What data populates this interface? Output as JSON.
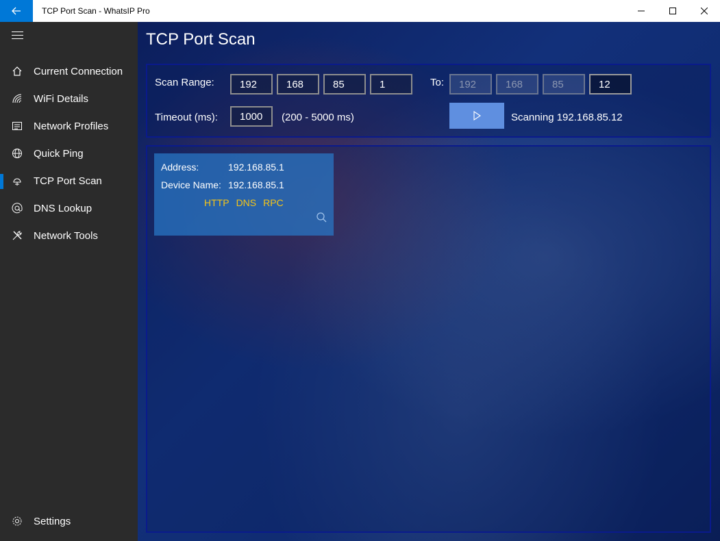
{
  "window": {
    "title": "TCP Port Scan - WhatsIP Pro"
  },
  "sidebar": {
    "items": [
      {
        "label": "Current Connection",
        "icon": "home-icon"
      },
      {
        "label": "WiFi Details",
        "icon": "wifi-icon"
      },
      {
        "label": "Network Profiles",
        "icon": "profiles-icon"
      },
      {
        "label": "Quick Ping",
        "icon": "globe-icon"
      },
      {
        "label": "TCP Port Scan",
        "icon": "port-scan-icon",
        "active": true
      },
      {
        "label": "DNS Lookup",
        "icon": "at-icon"
      },
      {
        "label": "Network Tools",
        "icon": "tools-icon"
      }
    ],
    "settings_label": "Settings"
  },
  "page": {
    "title": "TCP Port Scan"
  },
  "scan": {
    "range_label": "Scan Range:",
    "from": [
      "192",
      "168",
      "85",
      "1"
    ],
    "to_label": "To:",
    "to": [
      "192",
      "168",
      "85",
      "12"
    ],
    "timeout_label": "Timeout (ms):",
    "timeout": "1000",
    "timeout_hint": "(200 - 5000 ms)",
    "status": "Scanning 192.168.85.12"
  },
  "results": [
    {
      "address_label": "Address:",
      "address": "192.168.85.1",
      "device_label": "Device Name:",
      "device": "192.168.85.1",
      "ports": [
        "HTTP",
        "DNS",
        "RPC"
      ]
    }
  ],
  "colors": {
    "accent": "#0078d7",
    "port_text": "#f5c518",
    "card": "#2878c8"
  }
}
